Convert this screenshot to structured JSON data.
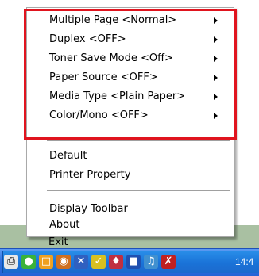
{
  "menu": {
    "submenu_items": [
      {
        "label": "Multiple Page <Normal>"
      },
      {
        "label": "Duplex <OFF>"
      },
      {
        "label": "Toner Save Mode <Off>"
      },
      {
        "label": "Paper Source <OFF>"
      },
      {
        "label": "Media Type <Plain Paper>"
      },
      {
        "label": "Color/Mono <OFF>"
      }
    ],
    "default_label": "Default",
    "printer_property_label": "Printer Property",
    "display_toolbar_label": "Display Toolbar",
    "about_label": "About",
    "exit_label": "Exit"
  },
  "taskbar": {
    "clock": "14:4"
  },
  "colors": {
    "highlight_border": "#e0141e",
    "taskbar": "#2564d6"
  }
}
